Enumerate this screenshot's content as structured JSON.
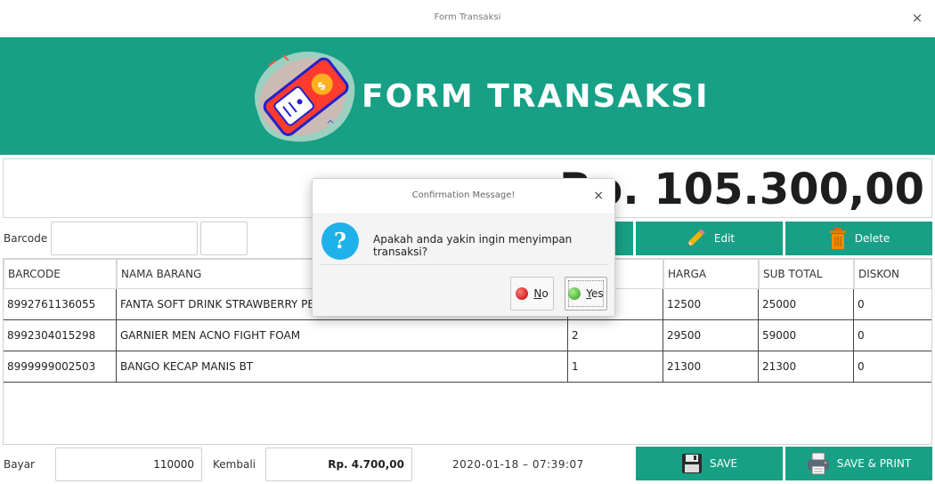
{
  "window": {
    "title": "Form Transaksi",
    "close_glyph": "×"
  },
  "banner": {
    "heading": "FORM TRANSAKSI",
    "logo": "game-controller-logo",
    "color": "#17a085"
  },
  "total": {
    "amount": "Rp. 105.300,00"
  },
  "entry": {
    "barcode_label": "Barcode",
    "barcode_value": "",
    "qty_value": ""
  },
  "actions": {
    "edit_label": "Edit",
    "delete_label": "Delete",
    "save_label": "SAVE",
    "save_print_label": "SAVE & PRINT"
  },
  "table": {
    "headers": [
      "BARCODE",
      "NAMA BARANG",
      "",
      "HARGA",
      "SUB TOTAL",
      "DISKON"
    ],
    "rows": [
      [
        "8992761136055",
        "FANTA SOFT DRINK STRAWBERRY PET",
        "",
        "12500",
        "25000",
        "0"
      ],
      [
        "8992304015298",
        "GARNIER MEN ACNO FIGHT FOAM",
        "2",
        "29500",
        "59000",
        "0"
      ],
      [
        "8999999002503",
        "BANGO KECAP MANIS BT",
        "1",
        "21300",
        "21300",
        "0"
      ]
    ]
  },
  "footer": {
    "bayar_label": "Bayar",
    "bayar_value": "110000",
    "kembali_label": "Kembali",
    "kembali_value": "Rp.  4.700,00",
    "datetime": "2020-01-18  –  07:39:07"
  },
  "dialog": {
    "title": "Confirmation Message!",
    "close_glyph": "×",
    "icon_glyph": "?",
    "message": "Apakah anda yakin ingin menyimpan transaksi?",
    "no_label_u": "N",
    "no_label_rest": "o",
    "yes_label_u": "Y",
    "yes_label_rest": "es",
    "no_color": "#d81818",
    "yes_color": "#3cb83c"
  }
}
